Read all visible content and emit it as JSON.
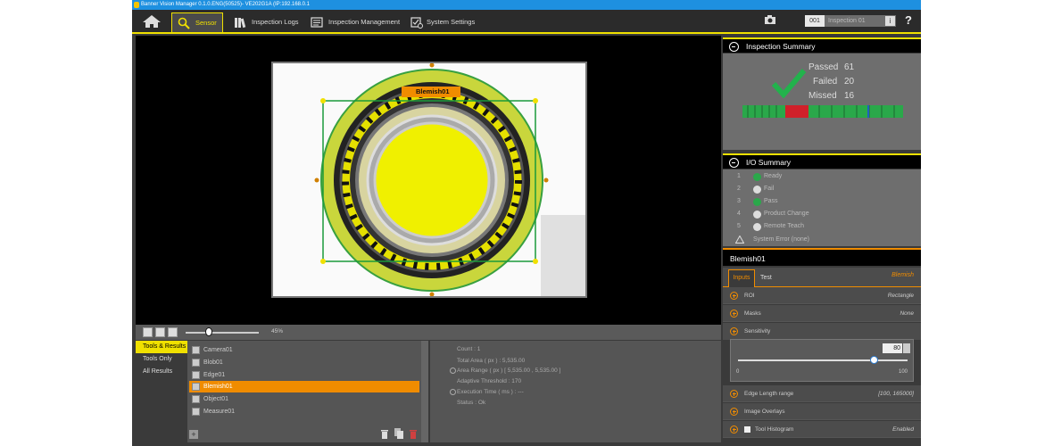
{
  "window": {
    "title": "Banner Vision Manager 0.1.0.ENG(50525)- VE202G1A (IP:192.168.0.1"
  },
  "nav": {
    "tabs": [
      {
        "label": "Sensor"
      },
      {
        "label": "Inspection Logs"
      },
      {
        "label": "Inspection Management"
      },
      {
        "label": "System Settings"
      }
    ],
    "inspection_number": "001",
    "inspection_name": "Inspection 01",
    "help_label": "?"
  },
  "viewer": {
    "roi_label": "Blemish01",
    "zoom": "45%"
  },
  "left_panel": {
    "items": [
      {
        "label": "Tools & Results"
      },
      {
        "label": "Tools Only"
      },
      {
        "label": "All Results"
      }
    ]
  },
  "tools": {
    "items": [
      {
        "label": "Camera01"
      },
      {
        "label": "Blob01"
      },
      {
        "label": "Edge01"
      },
      {
        "label": "Blemish01"
      },
      {
        "label": "Object01"
      },
      {
        "label": "Measure01"
      }
    ]
  },
  "results": {
    "rows": [
      {
        "label": "Count : 1"
      },
      {
        "label": "Total Area ( px ) : 5,535.00"
      },
      {
        "label": "Area Range ( px ) [ 5,535.00 , 5,535.00 ]"
      },
      {
        "label": "Adaptive Threshold : 170"
      },
      {
        "label": "Execution Time ( ms ) : ---"
      },
      {
        "label": "Status : Ok"
      }
    ]
  },
  "inspection_summary": {
    "title": "Inspection Summary",
    "passed_label": "Passed",
    "passed": "61",
    "failed_label": "Failed",
    "failed": "20",
    "missed_label": "Missed",
    "missed": "16",
    "colors": {
      "pass": "#2aa84a",
      "fail": "#d0202a",
      "check": "#22b24c"
    }
  },
  "io_summary": {
    "title": "I/O Summary",
    "items": [
      {
        "num": "1",
        "label": "Ready",
        "state": "on"
      },
      {
        "num": "2",
        "label": "Fail",
        "state": "off"
      },
      {
        "num": "3",
        "label": "Pass",
        "state": "on"
      },
      {
        "num": "4",
        "label": "Product Change",
        "state": "off"
      },
      {
        "num": "5",
        "label": "Remote Teach",
        "state": "off"
      }
    ],
    "system_error": "System Error (none)"
  },
  "tool_panel": {
    "title": "Blemish01",
    "tabs": [
      {
        "label": "Inputs"
      },
      {
        "label": "Test"
      }
    ],
    "tool_type": "Blemish",
    "roi_label": "ROI",
    "roi_value": "Rectangle",
    "masks_label": "Masks",
    "masks_value": "None",
    "sensitivity_label": "Sensitivity",
    "sensitivity_value": "80",
    "sensitivity_level": 80,
    "sensitivity_min": "0",
    "sensitivity_max": "100",
    "edge_label": "Edge Length range",
    "edge_value": "[100, 165000]",
    "overlays_label": "Image Overlays",
    "histogram_label": "Tool Histogram",
    "histogram_value": "Enabled"
  }
}
